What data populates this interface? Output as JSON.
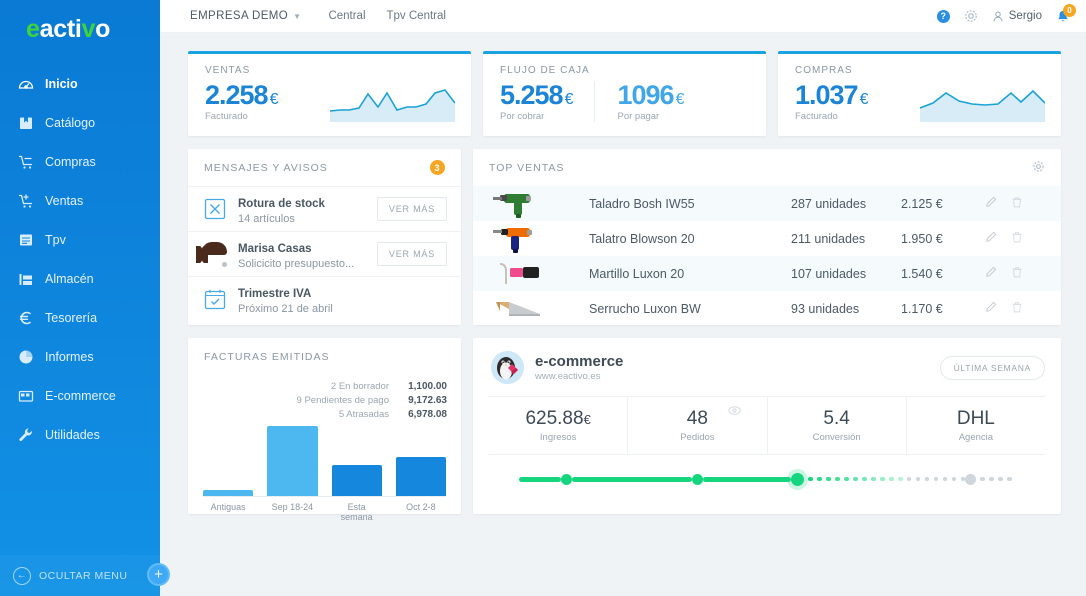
{
  "brand": {
    "logo_prefix": "e",
    "logo_mid": "acti",
    "logo_v": "v",
    "logo_suffix": "o",
    "green": "#3fd23f"
  },
  "sidebar": {
    "items": [
      {
        "label": "Inicio",
        "icon": "gauge-icon",
        "active": true
      },
      {
        "label": "Catálogo",
        "icon": "book-icon",
        "active": false
      },
      {
        "label": "Compras",
        "icon": "cart-minus-icon",
        "active": false
      },
      {
        "label": "Ventas",
        "icon": "cart-plus-icon",
        "active": false
      },
      {
        "label": "Tpv",
        "icon": "receipt-icon",
        "active": false
      },
      {
        "label": "Almacén",
        "icon": "warehouse-icon",
        "active": false
      },
      {
        "label": "Tesorería",
        "icon": "euro-icon",
        "active": false
      },
      {
        "label": "Informes",
        "icon": "pie-chart-icon",
        "active": false
      },
      {
        "label": "E-commerce",
        "icon": "storefront-icon",
        "active": false
      },
      {
        "label": "Utilidades",
        "icon": "wrench-icon",
        "active": false
      }
    ],
    "hide_menu_label": "OCULTAR MENU",
    "hide_menu_icon": "arrow-left-circle-icon",
    "fab_label": "+"
  },
  "topbar": {
    "company": "EMPRESA DEMO",
    "links": [
      "Central",
      "Tpv Central"
    ],
    "help_icon": "help-icon",
    "gear_icon": "gear-icon",
    "user_icon": "user-icon",
    "user_name": "Sergio",
    "bell_icon": "bell-icon",
    "notification_count": "0"
  },
  "kpis": [
    {
      "title": "VENTAS",
      "figures": [
        {
          "value": "2.258",
          "currency": "€",
          "sub": "Facturado",
          "light": false
        }
      ],
      "has_spark": true,
      "spark": [
        16,
        15,
        15,
        14,
        5,
        13,
        4,
        15,
        13,
        13,
        11,
        4,
        2,
        10
      ]
    },
    {
      "title": "FLUJO DE CAJA",
      "figures": [
        {
          "value": "5.258",
          "currency": "€",
          "sub": "Por cobrar",
          "light": false
        },
        {
          "value": "1096",
          "currency": "€",
          "sub": "Por pagar",
          "light": true
        }
      ],
      "has_spark": false,
      "spark": []
    },
    {
      "title": "COMPRAS",
      "figures": [
        {
          "value": "1.037",
          "currency": "€",
          "sub": "Facturado",
          "light": false
        }
      ],
      "has_spark": true,
      "spark": [
        14,
        6,
        4,
        12,
        13,
        14,
        13,
        5,
        12,
        3,
        13,
        12,
        11
      ]
    }
  ],
  "messages": {
    "title": "MENSAJES Y AVISOS",
    "count": "3",
    "items": [
      {
        "icon": "square-x-icon",
        "title": "Rotura de stock",
        "subtitle": "14 artículos",
        "action": "VER MÁS",
        "has_action": true
      },
      {
        "icon": "avatar",
        "title": "Marisa Casas",
        "subtitle": "Solicicito presupuesto...",
        "action": "VER MÁS",
        "has_action": true
      },
      {
        "icon": "calendar-check-icon",
        "title": "Trimestre IVA",
        "subtitle": "Próximo 21 de abril",
        "action": "",
        "has_action": false
      }
    ]
  },
  "top_ventas": {
    "title": "TOP VENTAS",
    "gear_icon": "gear-icon",
    "rows": [
      {
        "image": "drill-green-icon",
        "name": "Taladro Bosh IW55",
        "units": "287 unidades",
        "amount": "2.125 €",
        "edit_icon": "pencil-icon",
        "delete_icon": "trash-icon"
      },
      {
        "image": "drill-orange-icon",
        "name": "Talatro Blowson 20",
        "units": "211 unidades",
        "amount": "1.950 €",
        "edit_icon": "pencil-icon",
        "delete_icon": "trash-icon"
      },
      {
        "image": "hammer-icon",
        "name": "Martillo Luxon 20",
        "units": "107 unidades",
        "amount": "1.540 €",
        "edit_icon": "pencil-icon",
        "delete_icon": "trash-icon"
      },
      {
        "image": "saw-icon",
        "name": "Serrucho Luxon BW",
        "units": "93 unidades",
        "amount": "1.170 €",
        "edit_icon": "pencil-icon",
        "delete_icon": "trash-icon"
      }
    ]
  },
  "facturas": {
    "title": "FACTURAS EMITIDAS",
    "legend": [
      {
        "label": "2 En borrador",
        "value": "1,100.00"
      },
      {
        "label": "9 Pendientes de pago",
        "value": "9,172.63"
      },
      {
        "label": "5 Atrasadas",
        "value": "6,978.08"
      }
    ]
  },
  "chart_data": {
    "type": "bar",
    "title": "FACTURAS EMITIDAS",
    "categories": [
      "Antiguas",
      "Sep 18-24",
      "Esta semana",
      "Oct 2-8"
    ],
    "values": [
      6,
      70,
      31,
      39
    ],
    "colors": [
      "#4db8ef",
      "#4db8ef",
      "#1588dd",
      "#1588dd"
    ],
    "ylim": [
      0,
      72
    ],
    "xlabel": "",
    "ylabel": "",
    "grid": false,
    "legend_position": "top-right"
  },
  "ecommerce": {
    "logo_icon": "prestashop-penguin-icon",
    "title": "e-commerce",
    "url": "www.eactivo.es",
    "period_button": "ÚLTIMA SEMANA",
    "stats": [
      {
        "value": "625.88",
        "currency": "€",
        "label": "Ingresos",
        "has_eye": false
      },
      {
        "value": "48",
        "currency": "",
        "label": "Pedidos",
        "has_eye": true,
        "eye_icon": "eye-icon"
      },
      {
        "value": "5.4",
        "currency": "",
        "label": "Conversión",
        "has_eye": false
      },
      {
        "value": "DHL",
        "currency": "",
        "label": "Agencia",
        "has_eye": false
      }
    ],
    "progress": {
      "green_color": "#15d67e",
      "gray_color": "#cfd6dc",
      "segments": [
        42,
        120,
        88
      ],
      "green_dots": 11,
      "gray_dots_before_node": 7,
      "gray_dots_after_node": 4
    }
  }
}
